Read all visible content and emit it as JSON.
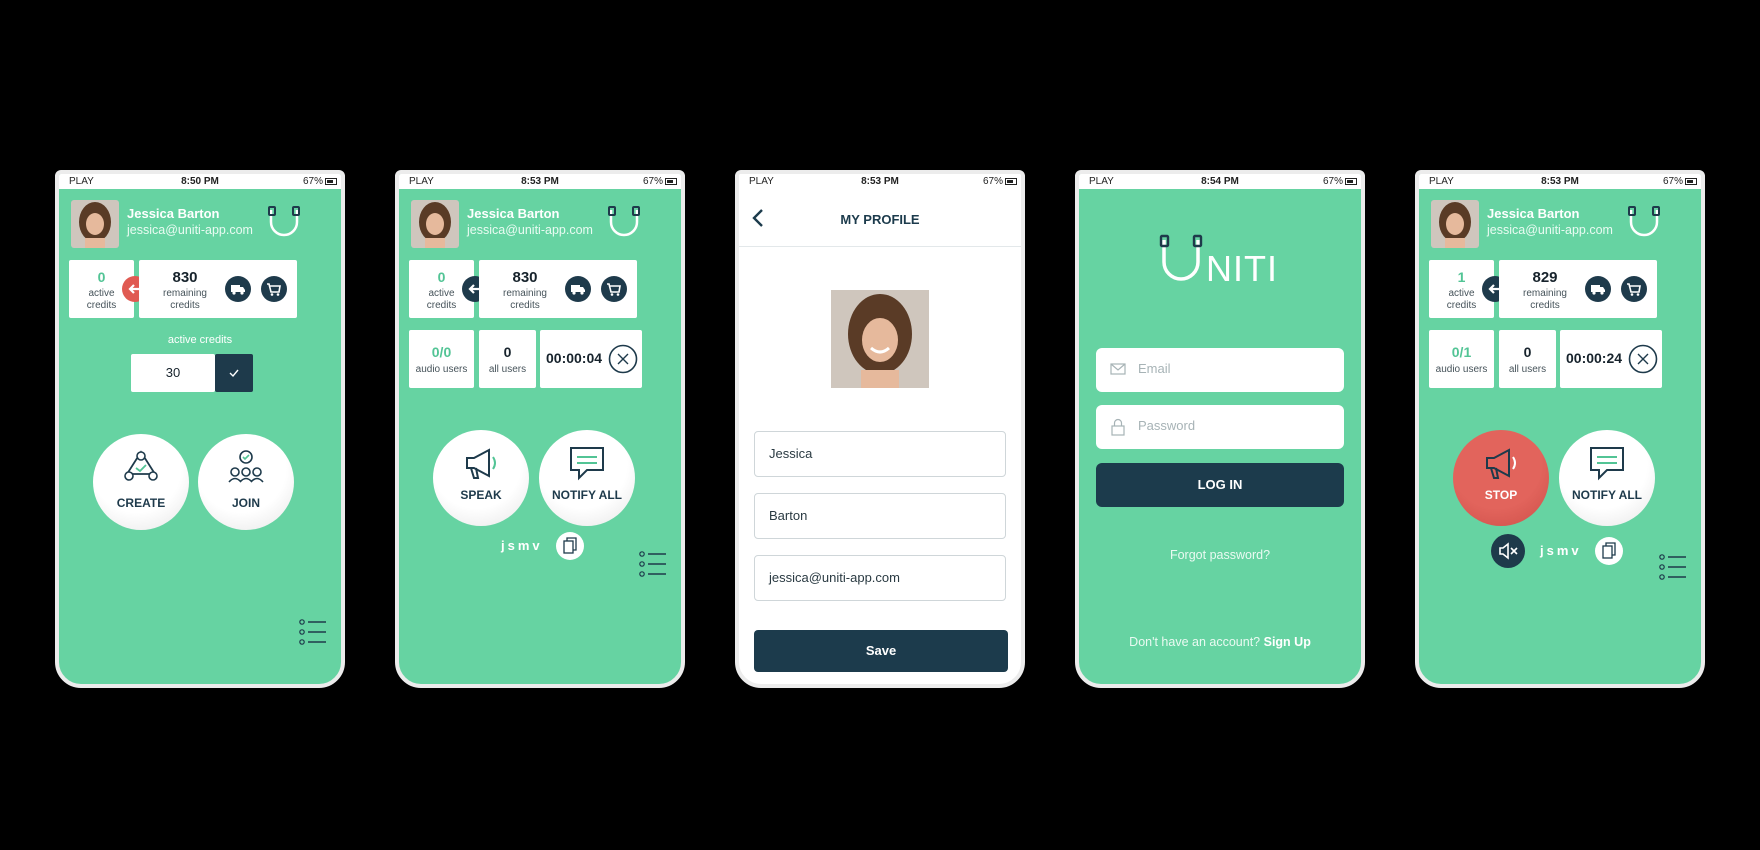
{
  "status_bar": [
    {
      "carrier": "PLAY",
      "time": "8:50 PM",
      "battery": "67%"
    },
    {
      "carrier": "PLAY",
      "time": "8:53 PM",
      "battery": "67%"
    },
    {
      "carrier": "PLAY",
      "time": "8:53 PM",
      "battery": "67%"
    },
    {
      "carrier": "PLAY",
      "time": "8:54 PM",
      "battery": "67%"
    },
    {
      "carrier": "PLAY",
      "time": "8:53 PM",
      "battery": "67%"
    }
  ],
  "user": {
    "name": "Jessica Barton",
    "email": "jessica@uniti-app.com"
  },
  "screen1": {
    "active_credits_value": "0",
    "active_credits_label": "active credits",
    "remaining_value": "830",
    "remaining_label": "remaining credits",
    "credits_input_label": "active credits",
    "credits_input_value": "30",
    "create_label": "CREATE",
    "join_label": "JOIN"
  },
  "screen2": {
    "active_credits_value": "0",
    "active_credits_label": "active credits",
    "remaining_value": "830",
    "remaining_label": "remaining credits",
    "audio_users_value": "0/0",
    "audio_users_label": "audio users",
    "all_users_value": "0",
    "all_users_label": "all users",
    "timer": "00:00:04",
    "speak_label": "SPEAK",
    "notify_label": "NOTIFY ALL",
    "code": "jsmv"
  },
  "screen3": {
    "title": "MY PROFILE",
    "first_name": "Jessica",
    "last_name": "Barton",
    "email": "jessica@uniti-app.com",
    "save_label": "Save"
  },
  "screen4": {
    "logo_text": "NITI",
    "email_placeholder": "Email",
    "password_placeholder": "Password",
    "login_label": "LOG IN",
    "forgot_label": "Forgot password?",
    "signup_prompt": "Don't have an account?",
    "signup_link": "Sign Up"
  },
  "screen5": {
    "active_credits_value": "1",
    "active_credits_label": "active credits",
    "remaining_value": "829",
    "remaining_label": "remaining credits",
    "audio_users_value": "0/1",
    "audio_users_label": "audio users",
    "all_users_value": "0",
    "all_users_label": "all users",
    "timer": "00:00:24",
    "stop_label": "STOP",
    "notify_label": "NOTIFY ALL",
    "code": "jsmv"
  },
  "colors": {
    "brand_green": "#66d3a2",
    "navy": "#1c3b4c",
    "stop_red": "#e05a52",
    "accent_green": "#52c495"
  },
  "icons": [
    "signal-icon",
    "wifi-icon",
    "location-icon",
    "bluetooth-icon",
    "battery-icon",
    "headset-logo-icon",
    "transfer-arrow-icon",
    "truck-icon",
    "cart-icon",
    "check-icon",
    "close-icon",
    "create-group-icon",
    "join-group-icon",
    "megaphone-icon",
    "chat-icon",
    "copy-icon",
    "menu-list-icon",
    "mute-icon",
    "back-chevron-icon",
    "mail-icon",
    "lock-icon"
  ]
}
